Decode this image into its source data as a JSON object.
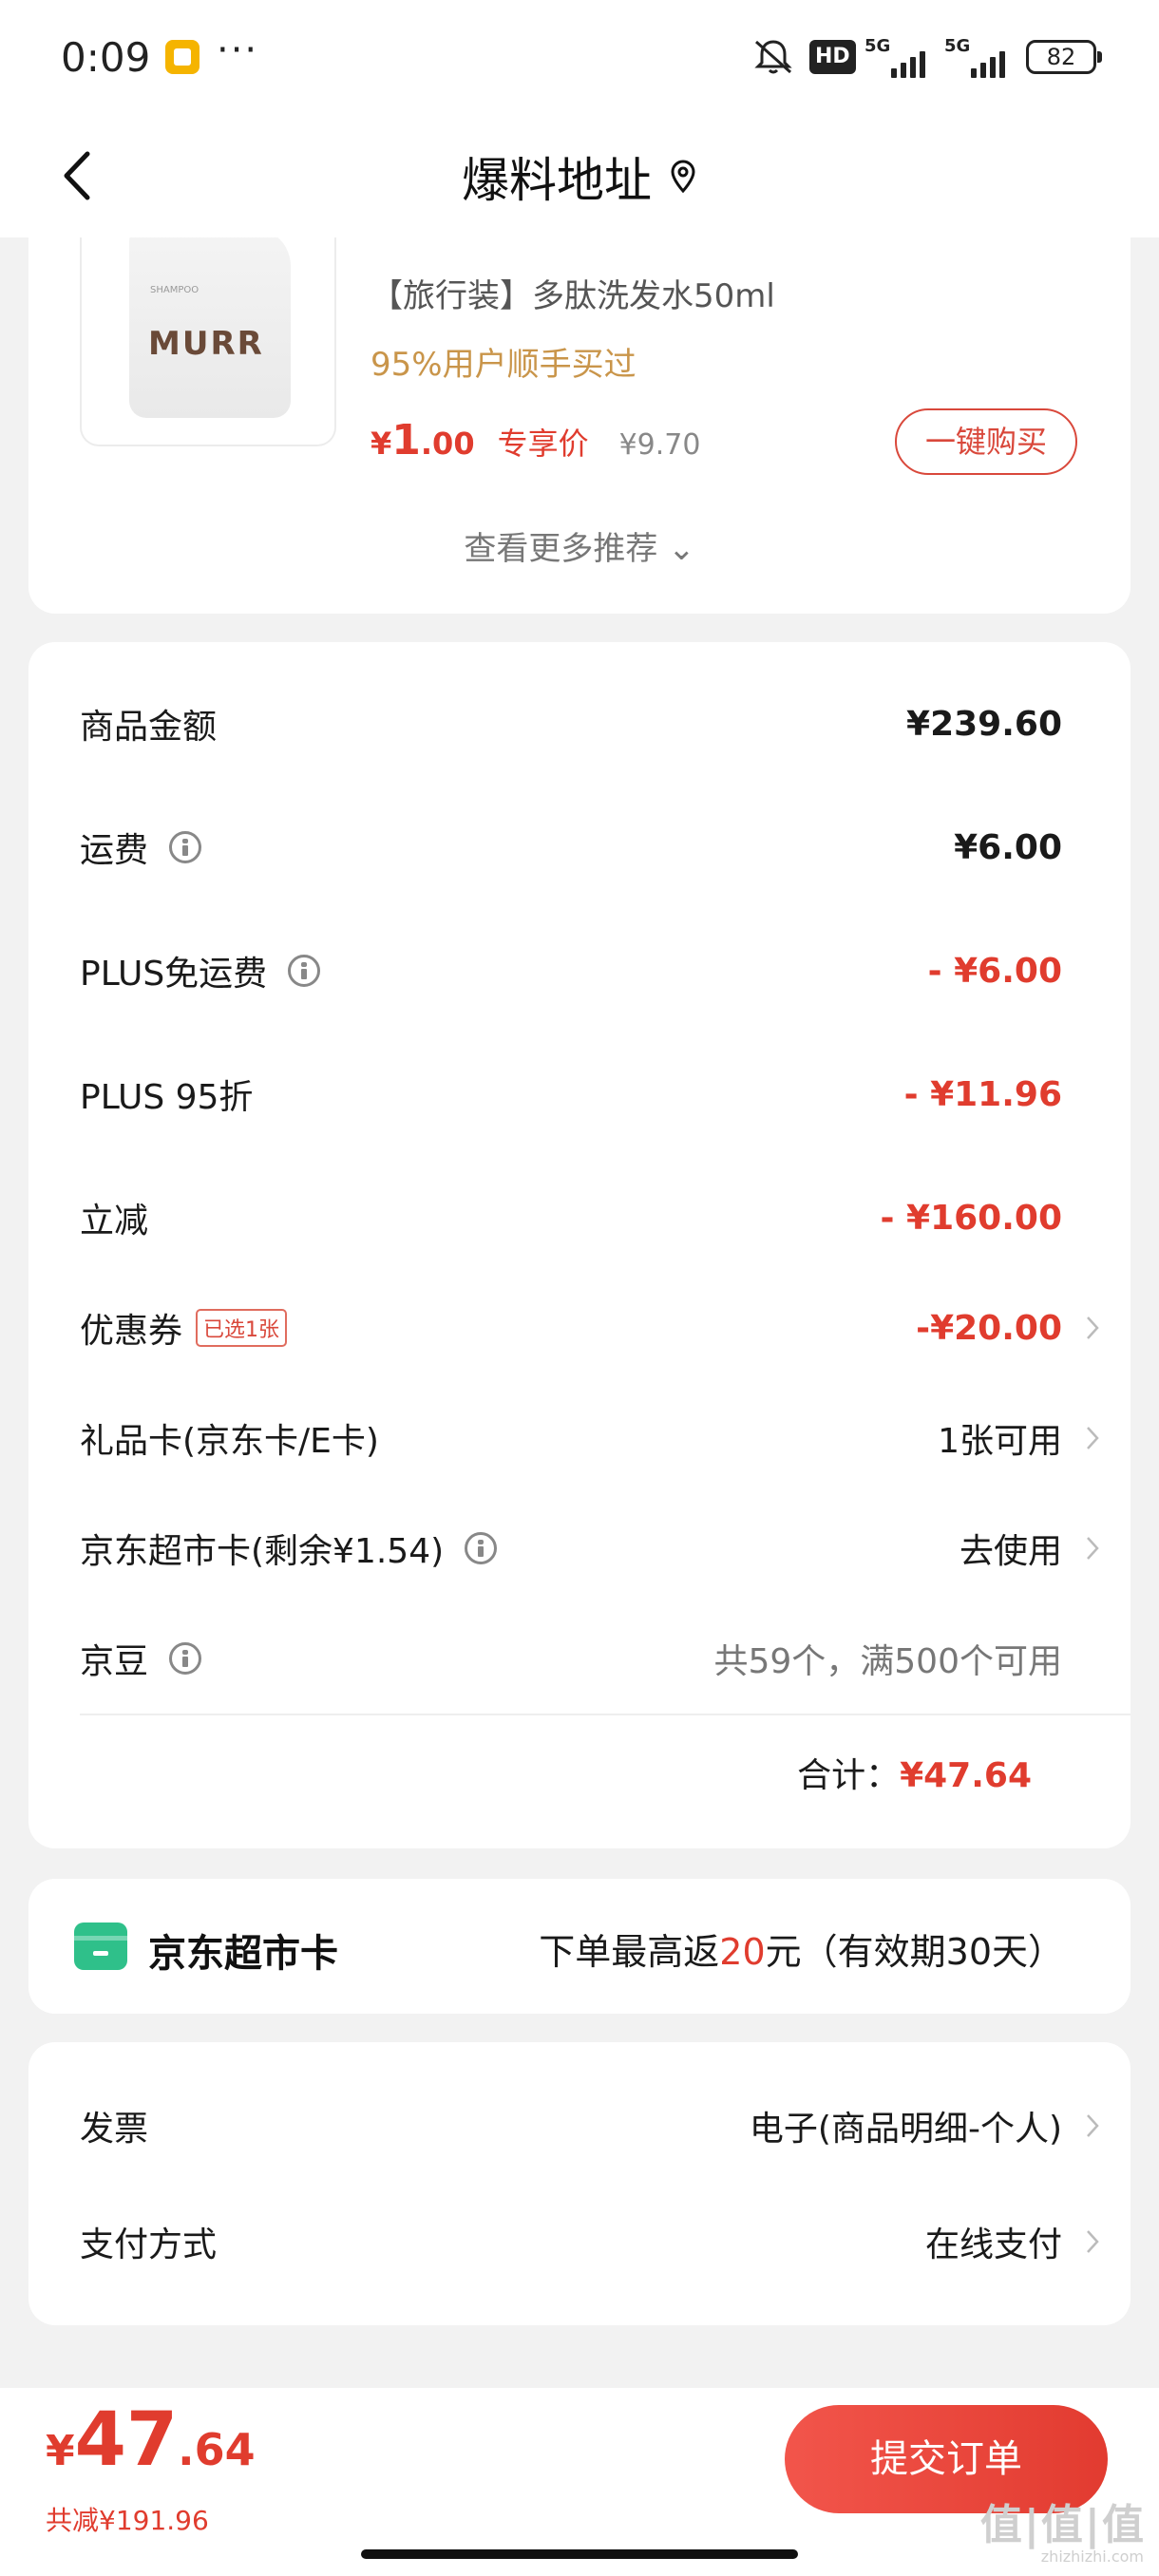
{
  "status_bar": {
    "time": "0:09",
    "dots": "···",
    "hd_label": "HD",
    "net1": "5G",
    "net2": "5G",
    "battery": "82"
  },
  "header": {
    "title": "爆料地址",
    "back_icon": "chevron-left-icon",
    "location_icon": "location-pin-icon"
  },
  "recommendation": {
    "product_name": "【旅行装】多肽洗发水50ml",
    "tag": "95%用户顺手买过",
    "price_yen": "¥",
    "price_int": "1",
    "price_dec": ".00",
    "price_label": "专享价",
    "original_price": "¥9.70",
    "buy_button": "一键购买",
    "brand_on_pack": "MURR",
    "more_link": "查看更多推荐 ⌄"
  },
  "summary": {
    "rows": [
      {
        "label": "商品金额",
        "value": "¥239.60"
      },
      {
        "label": "运费",
        "value": "¥6.00"
      },
      {
        "label": "PLUS免运费",
        "value": "- ¥6.00"
      },
      {
        "label": "PLUS 95折",
        "value": "- ¥11.96"
      },
      {
        "label": "立减",
        "value": "- ¥160.00"
      },
      {
        "label": "优惠券",
        "badge": "已选1张",
        "value": "-¥20.00"
      },
      {
        "label": "礼品卡(京东卡/E卡)",
        "value": "1张可用"
      },
      {
        "label": "京东超市卡(剩余¥1.54)",
        "value": "去使用"
      },
      {
        "label": "京豆",
        "value": "共59个，满500个可用"
      }
    ],
    "total_label": "合计：",
    "total_value": "¥47.64"
  },
  "supermarket_card": {
    "title": "京东超市卡",
    "desc_prefix": "下单最高返",
    "desc_highlight": "20",
    "desc_suffix": "元（有效期30天）"
  },
  "payment": {
    "invoice_label": "发票",
    "invoice_value": "电子(商品明细-个人)",
    "method_label": "支付方式",
    "method_value": "在线支付"
  },
  "bottom": {
    "price_yen": "¥",
    "price_int": "47",
    "price_dec": ".64",
    "saved": "共减¥191.96",
    "submit_button": "提交订单",
    "watermark": "值|值|值",
    "watermark_sub": "zhizhizhi.com"
  },
  "colors": {
    "accent_red": "#e03c2e",
    "gold_tag": "#c9954a",
    "card_green": "#2fc08a"
  }
}
